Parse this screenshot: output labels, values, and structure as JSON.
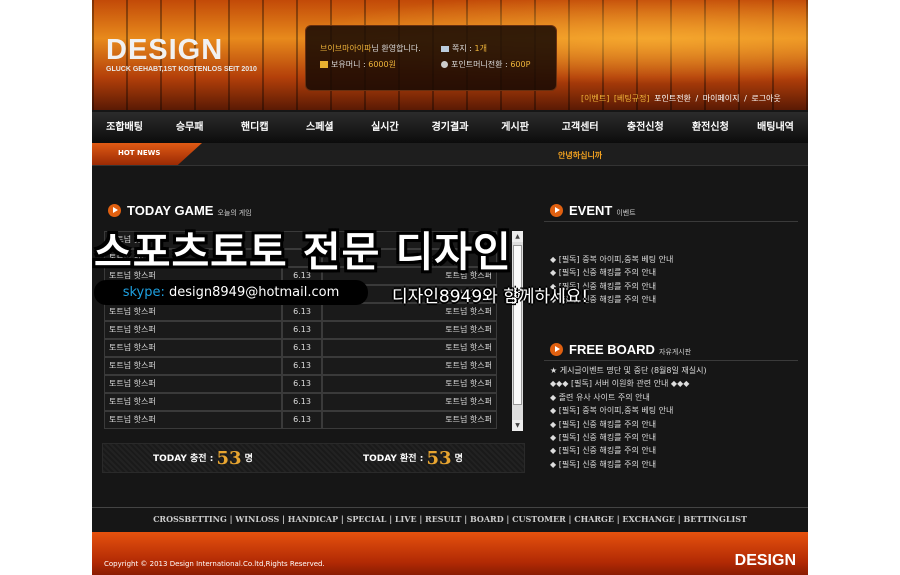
{
  "header": {
    "logo": "DESIGN",
    "logo_sub": "GLUCK GEHABT,1ST KOSTENLOS SEIT 2010",
    "user_name": "브이브마아이파",
    "welcome": "님 환영합니다.",
    "money_label": "보유머니 :",
    "money_value": "6000원",
    "memo_label": "쪽지 :",
    "memo_value": "1개",
    "point_label": "포인트머니전환 :",
    "point_value": "600P",
    "links": [
      "[이벤트]",
      "[베팅규정]",
      "포인트전환",
      "/",
      "마이페이지",
      "/",
      "로그아웃"
    ]
  },
  "nav": [
    "조합배팅",
    "승무패",
    "핸디캡",
    "스페셜",
    "실시간",
    "경기결과",
    "게시판",
    "고객센터",
    "충전신청",
    "환전신청",
    "배팅내역"
  ],
  "news": {
    "label": "HOT NEWS",
    "text": "안녕하십니까"
  },
  "today_game": {
    "title": "TODAY GAME",
    "subtitle": "오늘의 게임",
    "rows": [
      {
        "left": "토트넘 핫스퍼",
        "date": "",
        "right": ""
      },
      {
        "left": "토트넘 핫스퍼",
        "date": "",
        "right": ""
      },
      {
        "left": "토트넘 핫스퍼",
        "date": "6.13",
        "right": "토트넘 핫스퍼"
      },
      {
        "left": "토트넘 핫스퍼",
        "date": "6.13",
        "right": "토트넘 핫스퍼"
      },
      {
        "left": "토트넘 핫스퍼",
        "date": "6.13",
        "right": "토트넘 핫스퍼"
      },
      {
        "left": "토트넘 핫스퍼",
        "date": "6.13",
        "right": "토트넘 핫스퍼"
      },
      {
        "left": "토트넘 핫스퍼",
        "date": "6.13",
        "right": "토트넘 핫스퍼"
      },
      {
        "left": "토트넘 핫스퍼",
        "date": "6.13",
        "right": "토트넘 핫스퍼"
      },
      {
        "left": "토트넘 핫스퍼",
        "date": "6.13",
        "right": "토트넘 핫스퍼"
      },
      {
        "left": "토트넘 핫스퍼",
        "date": "6.13",
        "right": "토트넘 핫스퍼"
      },
      {
        "left": "토트넘 핫스퍼",
        "date": "6.13",
        "right": "토트넘 핫스퍼"
      }
    ],
    "charge_label": "TODAY 충전 :",
    "charge_value": "53",
    "exchange_label": "TODAY 환전 :",
    "exchange_value": "53",
    "unit": "명"
  },
  "event": {
    "title": "EVENT",
    "subtitle": "이벤트",
    "items": [
      "",
      "",
      "◆ [필독] 중복 아이피,중복 베팅 안내",
      "◆ [필독] 신중 해킹를 주의 안내",
      "◆ [필독] 신중 해킹를 주의 안내",
      "◆ [필독] 신중 해킹를 주의 안내"
    ]
  },
  "board": {
    "title": "FREE BOARD",
    "subtitle": "자유게시판",
    "items": [
      "★ 게시글이벤트 명단 및 중단 (8월8일 재실시)",
      "◆◆◆ [필독] 서버 이원화 관련 안내 ◆◆◆",
      "◆ 졸련 유사 사이트 주의 안내",
      "◆ [필독] 중복 아이피,중복 베팅 안내",
      "◆ [필독] 신중 해킹를 주의 안내",
      "◆ [필독] 신중 해킹를 주의 안내",
      "◆ [필독] 신중 해킹를 주의 안내",
      "◆ [필독] 신중 해킹를 주의 안내"
    ]
  },
  "overlay": {
    "headline": "스포츠토토 전문 디자인",
    "skype_label": "skype:",
    "skype_value": "design8949@hotmail.com",
    "cta": "디자인8949와 함께하세요!"
  },
  "footer": {
    "nav": "CROSSBETTING | WINLOSS | HANDICAP | SPECIAL | LIVE | RESULT | BOARD | CUSTOMER | CHARGE | EXCHANGE | BETTINGLIST",
    "copyright": "Copyright © 2013 Design International.Co.ltd,Rights Reserved.",
    "logo": "DESIGN"
  }
}
